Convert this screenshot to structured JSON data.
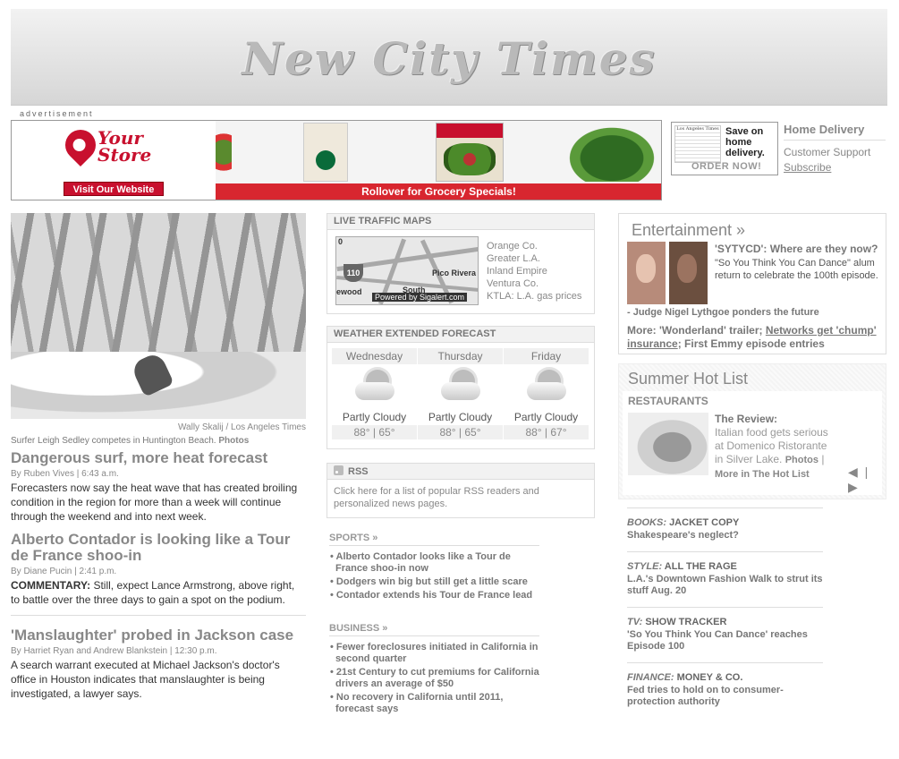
{
  "masthead": {
    "title": "New City Times"
  },
  "ad": {
    "label": "advertisement",
    "brand": "Your Store",
    "visit_button": "Visit Our Website",
    "rollover": "Rollover for Grocery Specials!"
  },
  "delivery": {
    "promo_paper": "Los Angeles Times",
    "promo_save": "Save on home delivery.",
    "promo_order": "ORDER NOW!",
    "home_delivery": "Home Delivery",
    "customer_support": "Customer Support",
    "subscribe": "Subscribe"
  },
  "lead": {
    "photo_credit": "Wally Skalij / Los Angeles Times",
    "caption": "Surfer Leigh Sedley competes in Huntington Beach.",
    "caption_link": "Photos"
  },
  "stories": [
    {
      "headline": "Dangerous surf, more heat forecast",
      "byline": "By Ruben Vives | 6:43 a.m.",
      "summary": "Forecasters now say the heat wave that has created broiling condition in the region for more than a week will continue through the weekend and into next week."
    },
    {
      "headline": "Alberto Contador is looking like a Tour de France shoo-in",
      "byline": "By Diane Pucin | 2:41 p.m.",
      "summary_label": "COMMENTARY:",
      "summary": "Still, expect Lance Armstrong, above right, to battle over the three days to gain a spot on the podium."
    },
    {
      "headline": "'Manslaughter' probed in Jackson case",
      "byline": "By Harriet Ryan and Andrew Blankstein | 12:30 p.m.",
      "summary": "A search warrant executed at Michael Jackson's doctor's office in Houston indicates that manslaughter is being investigated, a lawyer says."
    }
  ],
  "traffic": {
    "header": "LIVE TRAFFIC MAPS",
    "map_powered": "Powered by Sigalert.com",
    "map_shield": "110",
    "map_label_pico": "Pico Rivera",
    "map_label_left": "ewood",
    "map_label_south": "South",
    "map_label_zero": "0",
    "links": [
      "Orange Co.",
      "Greater L.A.",
      "Inland Empire",
      "Ventura Co.",
      "KTLA: L.A. gas prices"
    ]
  },
  "weather": {
    "header": "WEATHER",
    "extended": "EXTENDED FORECAST",
    "days": [
      {
        "day": "Wednesday",
        "cond": "Partly Cloudy",
        "temps": "88° | 65°"
      },
      {
        "day": "Thursday",
        "cond": "Partly Cloudy",
        "temps": "88° | 65°"
      },
      {
        "day": "Friday",
        "cond": "Partly Cloudy",
        "temps": "88° | 67°"
      }
    ]
  },
  "rss": {
    "header": "RSS",
    "text": "Click here for a list of popular RSS readers and personalized news pages."
  },
  "sports": {
    "header": "SPORTS »",
    "items": [
      "Alberto Contador looks like a Tour de France shoo-in now",
      "Dodgers win big but still get a little scare",
      "Contador extends his Tour de France lead"
    ]
  },
  "business": {
    "header": "BUSINESS »",
    "items": [
      "Fewer foreclosures initiated in California in second quarter",
      "21st Century to cut premiums for California drivers an average of $50",
      "No recovery in California until 2011, forecast says"
    ]
  },
  "entertainment": {
    "header": "Entertainment »",
    "headline": "'SYTYCD': Where are they now?",
    "summary": "\"So You Think You Can Dance\" alum return to celebrate the 100th episode.",
    "note": "- Judge Nigel Lythgoe ponders the future",
    "more_prefix": "More: 'Wonderland' trailer;",
    "more_link": "Networks get 'chump' insurance",
    "more_suffix": "; First Emmy episode entries"
  },
  "hotlist": {
    "header": "Summer Hot List",
    "category": "RESTAURANTS",
    "review_title": "The Review:",
    "review_text": "Italian food gets serious at Domenico Ristorante in Silver Lake.",
    "photos_link": "Photos",
    "more_link": "More in The Hot List",
    "nav": "◀ | ▶"
  },
  "features": [
    {
      "kicker": "BOOKS:",
      "section": "JACKET COPY",
      "title": "Shakespeare's neglect?"
    },
    {
      "kicker": "STYLE:",
      "section": "ALL THE RAGE",
      "title": "L.A.'s Downtown Fashion Walk to strut its stuff Aug. 20"
    },
    {
      "kicker": "TV:",
      "section": "SHOW TRACKER",
      "title": "'So You Think You Can Dance' reaches Episode 100"
    },
    {
      "kicker": "FINANCE:",
      "section": "MONEY & CO.",
      "title": "Fed tries to hold on to consumer-protection authority"
    }
  ]
}
